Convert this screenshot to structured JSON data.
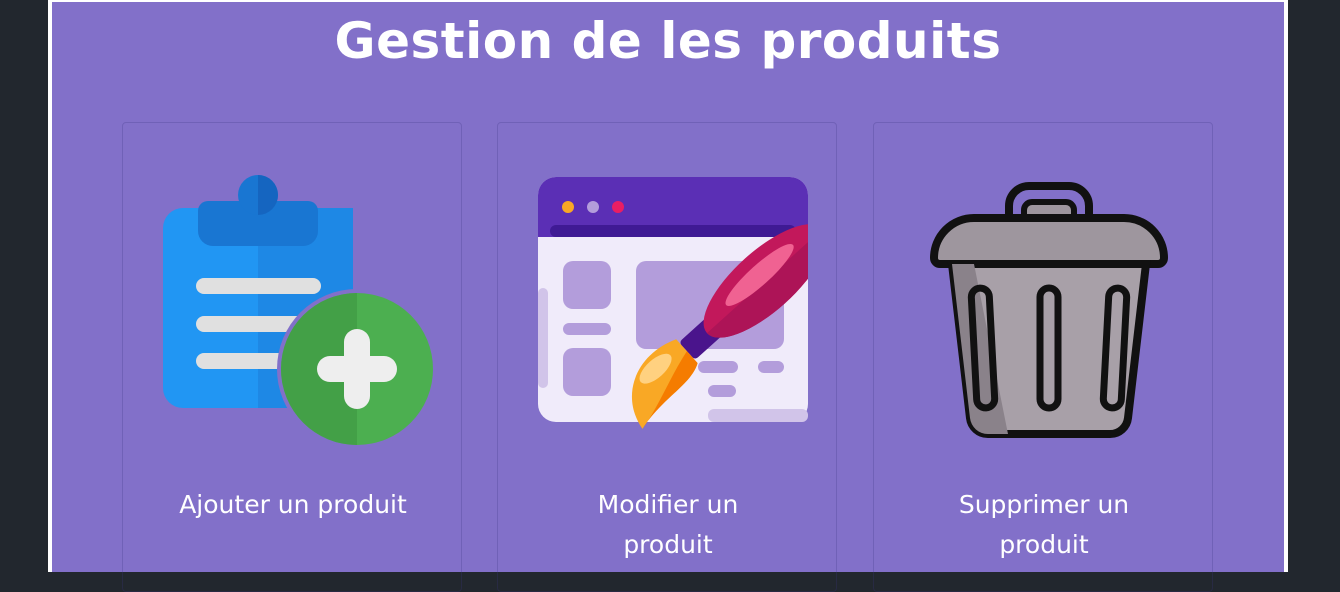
{
  "page": {
    "title": "Gestion de les produits"
  },
  "cards": [
    {
      "label_line1": "Ajouter un produit",
      "label_line2": "",
      "icon": "clipboard-add-icon"
    },
    {
      "label_line1": "Modifier un",
      "label_line2": "produit",
      "icon": "paintbrush-edit-icon"
    },
    {
      "label_line1": "Supprimer un",
      "label_line2": "produit",
      "icon": "trash-can-icon"
    }
  ],
  "colors": {
    "background": "#22272e",
    "panel": "#8270c9",
    "text": "#ffffff"
  }
}
